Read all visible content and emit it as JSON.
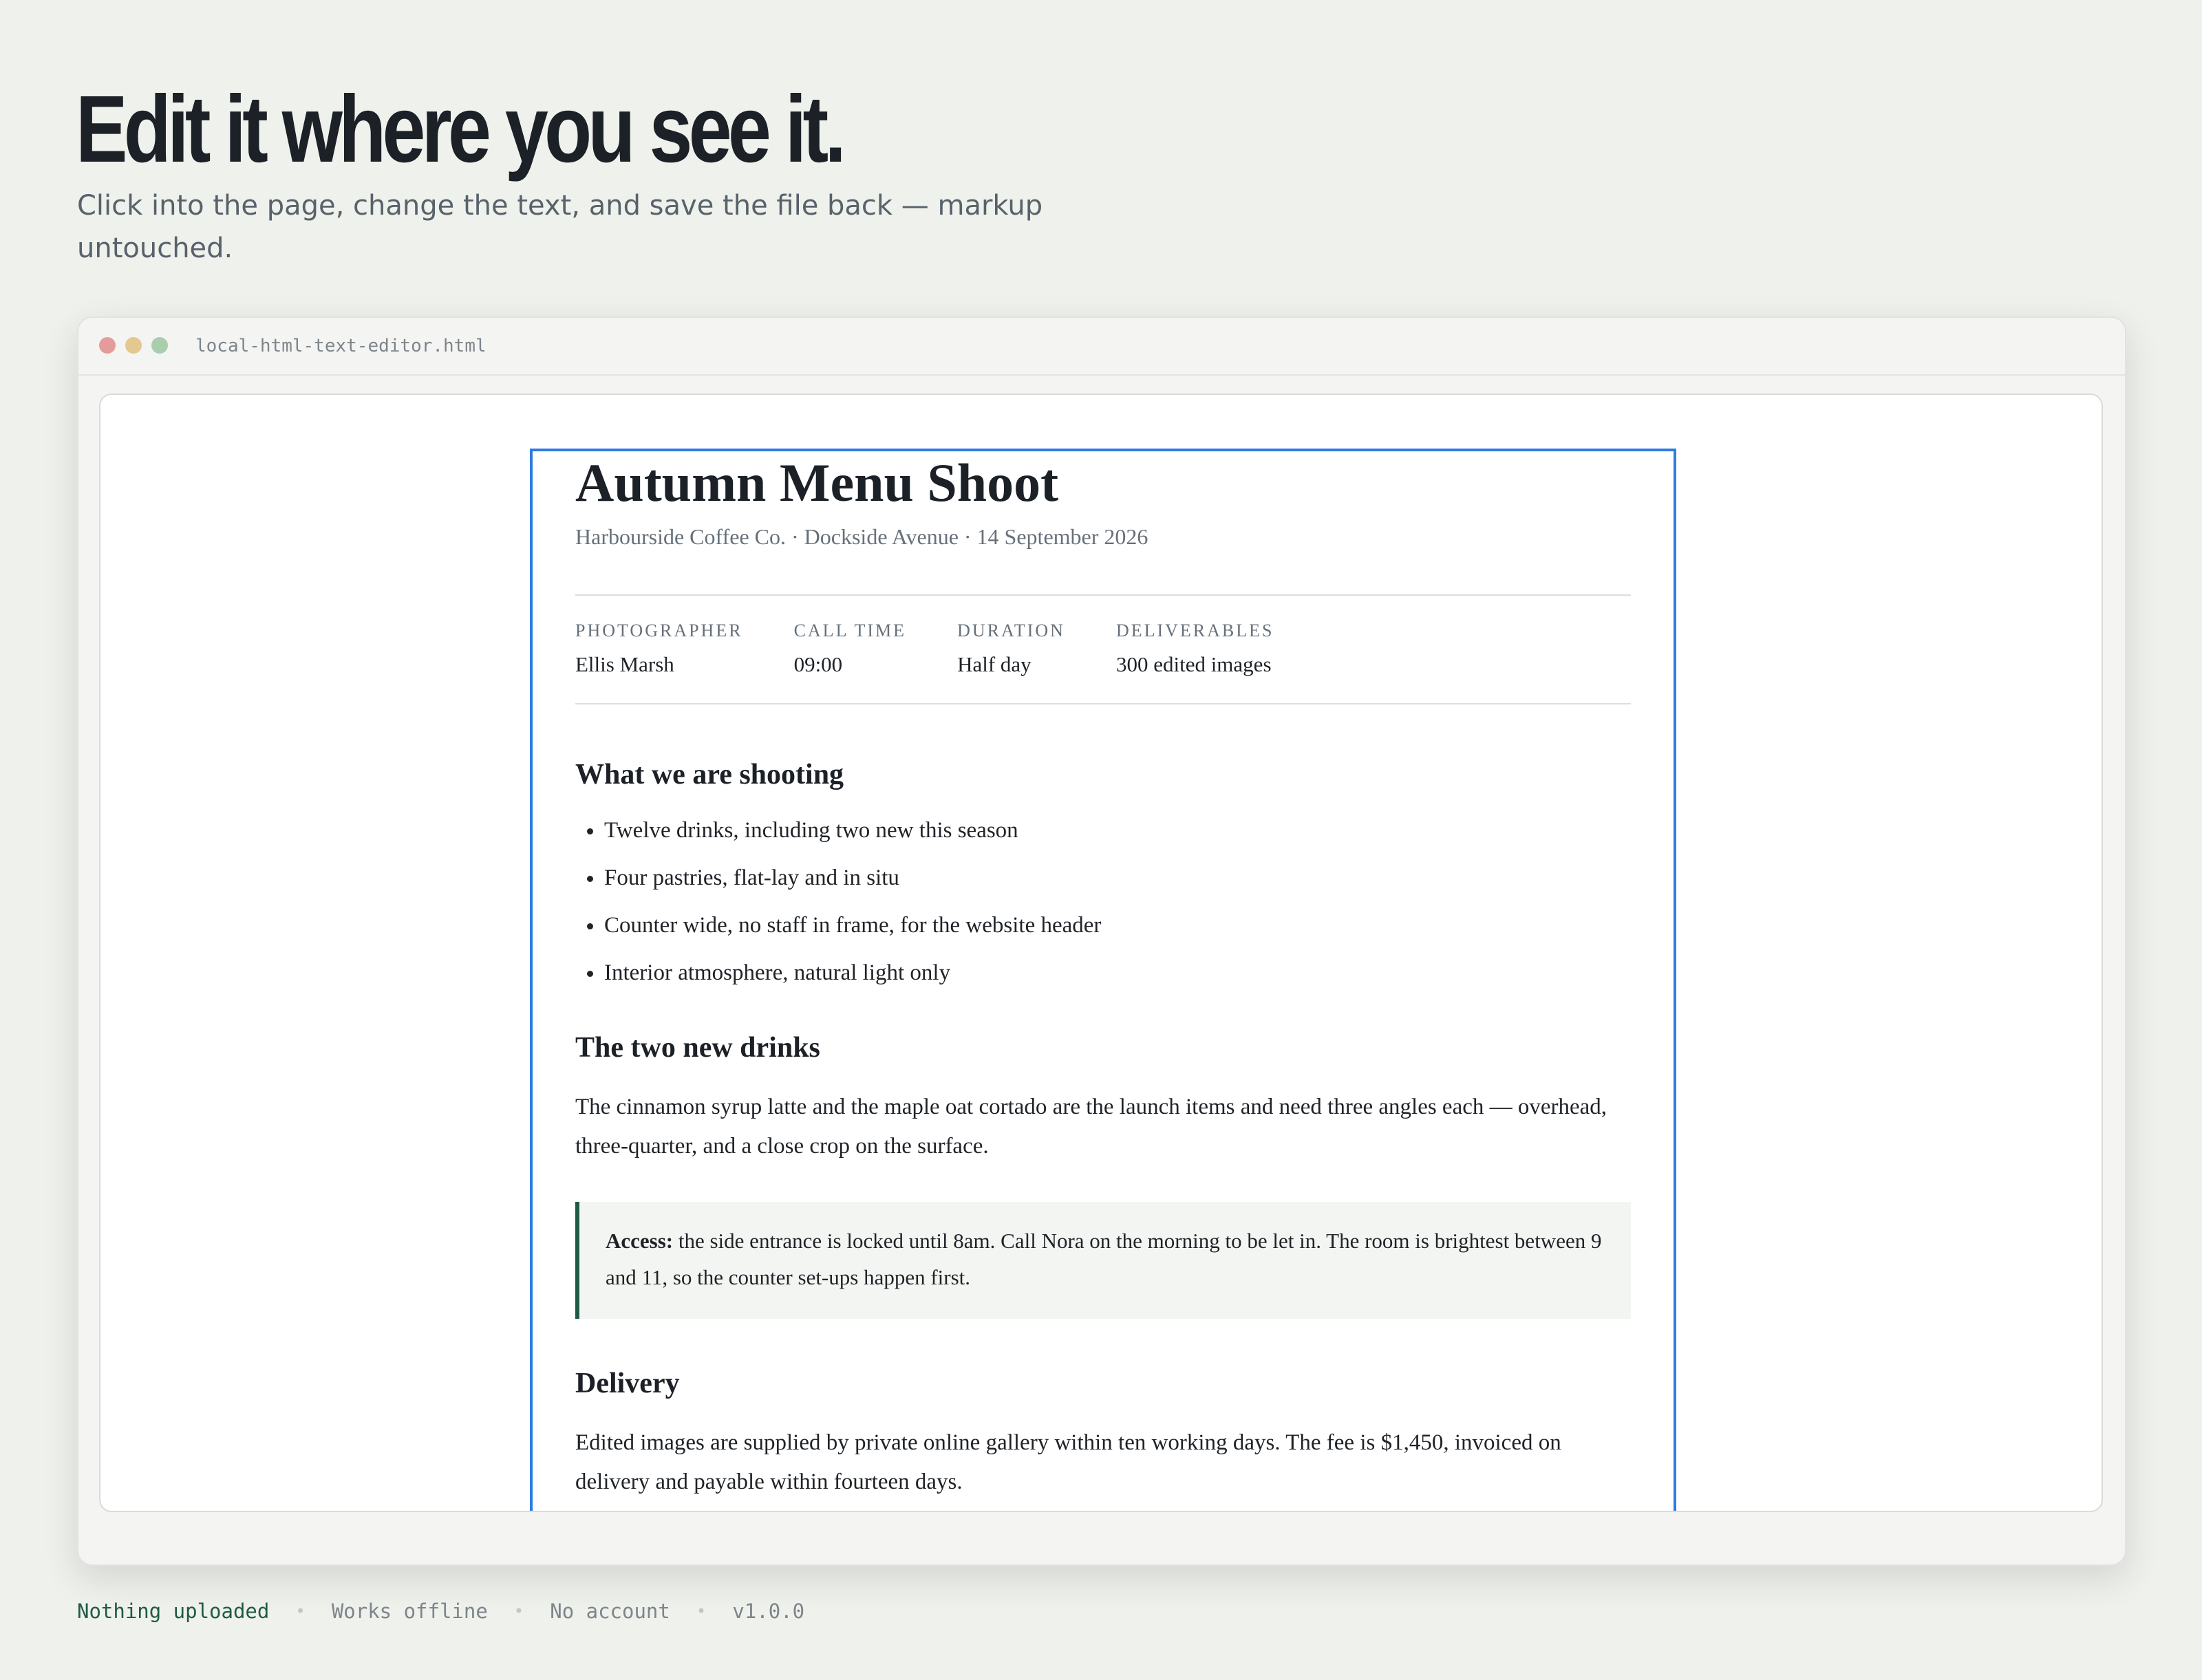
{
  "hero": {
    "title": "Edit it where you see it.",
    "subtitle": "Click into the page, change the text, and save the file back — markup untouched."
  },
  "window": {
    "filename": "local-html-text-editor.html"
  },
  "document": {
    "title": "Autumn Menu Shoot",
    "meta": "Harbourside Coffee Co. · Dockside Avenue · 14 September 2026",
    "facts": [
      {
        "label": "Photographer",
        "value": "Ellis Marsh"
      },
      {
        "label": "Call time",
        "value": "09:00"
      },
      {
        "label": "Duration",
        "value": "Half day"
      },
      {
        "label": "Deliverables",
        "value": "300 edited images"
      }
    ],
    "shooting_heading": "What we are shooting",
    "shooting_items": [
      "Twelve drinks, including two new this season",
      "Four pastries, flat-lay and in situ",
      "Counter wide, no staff in frame, for the website header",
      "Interior atmosphere, natural light only"
    ],
    "new_drinks_heading": "The two new drinks",
    "new_drinks_text": "The cinnamon syrup latte and the maple oat cortado are the launch items and need three angles each — overhead, three-quarter, and a close crop on the surface.",
    "callout_label": "Access:",
    "callout_text": " the side entrance is locked until 8am. Call Nora on the morning to be let in. The room is brightest between 9 and 11, so the counter set-ups happen first.",
    "delivery_heading": "Delivery",
    "delivery_text": "Edited images are supplied by private online gallery within ten working days. The fee is $1,450, invoiced on delivery and payable within fourteen days."
  },
  "footer": {
    "items": [
      "Nothing uploaded",
      "Works offline",
      "No account",
      "v1.0.0"
    ],
    "accent_color": "#1f5a46"
  },
  "colors": {
    "background": "#eff1ec",
    "editor_outline": "#2d7be0",
    "callout_border": "#1f5a46"
  }
}
